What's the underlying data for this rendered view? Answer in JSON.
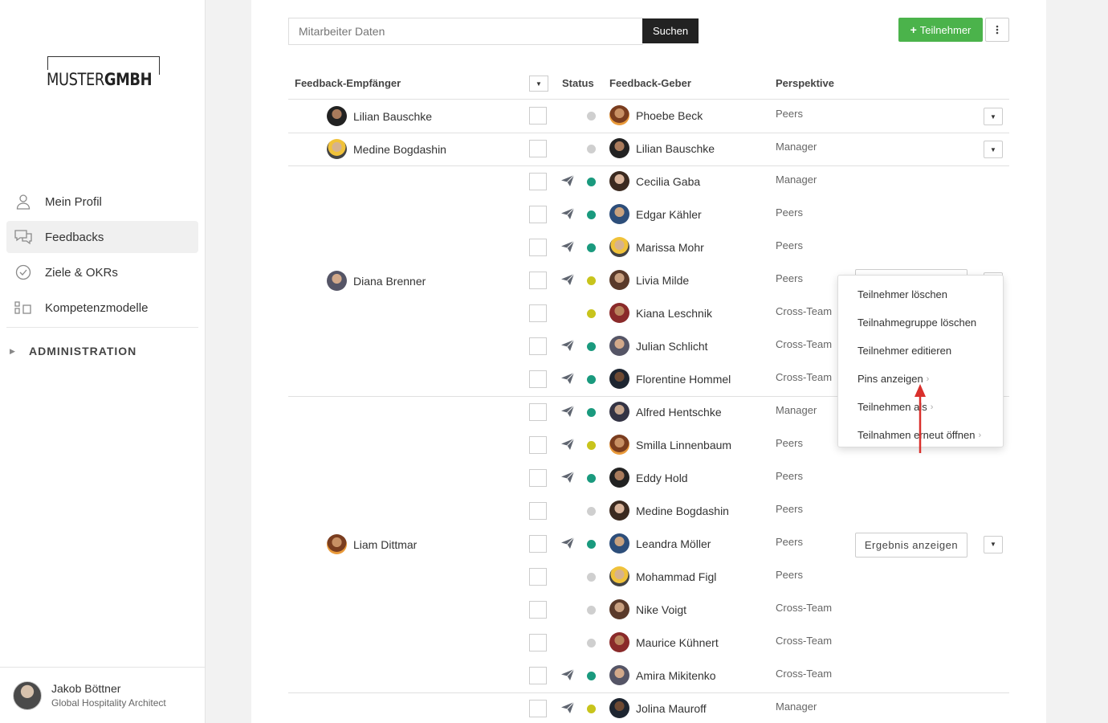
{
  "sidebar": {
    "logo": {
      "part1": "MUSTER",
      "part2": "GMBH"
    },
    "nav": [
      {
        "label": "Mein Profil",
        "icon": "person-icon"
      },
      {
        "label": "Feedbacks",
        "icon": "chat-bubbles-icon"
      },
      {
        "label": "Ziele & OKRs",
        "icon": "check-circle-icon"
      },
      {
        "label": "Kompetenzmodelle",
        "icon": "model-blocks-icon"
      }
    ],
    "admin_label": "ADMINISTRATION",
    "user": {
      "name": "Jakob Böttner",
      "title": "Global Hospitality Architect"
    }
  },
  "toolbar": {
    "search_placeholder": "Mitarbeiter Daten",
    "search_button": "Suchen",
    "add_button": "Teilnehmer",
    "more_button": "⋮"
  },
  "table": {
    "headers": {
      "recipient": "Feedback-Empfänger",
      "status": "Status",
      "giver": "Feedback-Geber",
      "perspective": "Perspektive"
    },
    "result_button": "Ergebnis anzeigen",
    "groups": [
      {
        "recipient": "Lilian Bauschke",
        "rows": [
          {
            "giver": "Phoebe Beck",
            "perspective": "Peers",
            "status": "grey",
            "sent": false
          }
        ]
      },
      {
        "recipient": "Medine Bogdashin",
        "rows": [
          {
            "giver": "Lilian Bauschke",
            "perspective": "Manager",
            "status": "grey",
            "sent": false
          }
        ]
      },
      {
        "recipient": "Diana Brenner",
        "rows": [
          {
            "giver": "Cecilia Gaba",
            "perspective": "Manager",
            "status": "green",
            "sent": true
          },
          {
            "giver": "Edgar Kähler",
            "perspective": "Peers",
            "status": "green",
            "sent": true
          },
          {
            "giver": "Marissa Mohr",
            "perspective": "Peers",
            "status": "green",
            "sent": true
          },
          {
            "giver": "Livia Milde",
            "perspective": "Peers",
            "status": "yellow",
            "sent": true
          },
          {
            "giver": "Kiana Leschnik",
            "perspective": "Cross-Team",
            "status": "yellow",
            "sent": false
          },
          {
            "giver": "Julian Schlicht",
            "perspective": "Cross-Team",
            "status": "green",
            "sent": true
          },
          {
            "giver": "Florentine Hommel",
            "perspective": "Cross-Team",
            "status": "green",
            "sent": true
          }
        ]
      },
      {
        "recipient": "Liam Dittmar",
        "rows": [
          {
            "giver": "Alfred Hentschke",
            "perspective": "Manager",
            "status": "green",
            "sent": true
          },
          {
            "giver": "Smilla Linnenbaum",
            "perspective": "Peers",
            "status": "yellow",
            "sent": true
          },
          {
            "giver": "Eddy Hold",
            "perspective": "Peers",
            "status": "green",
            "sent": true
          },
          {
            "giver": "Medine Bogdashin",
            "perspective": "Peers",
            "status": "grey",
            "sent": false
          },
          {
            "giver": "Leandra Möller",
            "perspective": "Peers",
            "status": "green",
            "sent": true
          },
          {
            "giver": "Mohammad Figl",
            "perspective": "Peers",
            "status": "grey",
            "sent": false
          },
          {
            "giver": "Nike Voigt",
            "perspective": "Cross-Team",
            "status": "grey",
            "sent": false
          },
          {
            "giver": "Maurice Kühnert",
            "perspective": "Cross-Team",
            "status": "grey",
            "sent": false
          },
          {
            "giver": "Amira Mikitenko",
            "perspective": "Cross-Team",
            "status": "green",
            "sent": true
          }
        ]
      },
      {
        "recipient": "",
        "rows": [
          {
            "giver": "Jolina Mauroff",
            "perspective": "Manager",
            "status": "yellow",
            "sent": true
          }
        ]
      }
    ]
  },
  "context_menu": {
    "items": [
      {
        "label": "Teilnehmer löschen",
        "submenu": false
      },
      {
        "label": "Teilnahmegruppe löschen",
        "submenu": false
      },
      {
        "label": "Teilnehmer editieren",
        "submenu": false
      },
      {
        "label": "Pins anzeigen",
        "submenu": true
      },
      {
        "label": "Teilnehmen als",
        "submenu": true
      },
      {
        "label": "Teilnahmen erneut öffnen",
        "submenu": true
      }
    ]
  },
  "colors": {
    "status_green": "#1a9a7e",
    "status_yellow": "#c8c41c",
    "status_grey": "#cfcfcf",
    "add_button": "#4bb34b",
    "search_button": "#222222",
    "arrow": "#d9302c"
  }
}
